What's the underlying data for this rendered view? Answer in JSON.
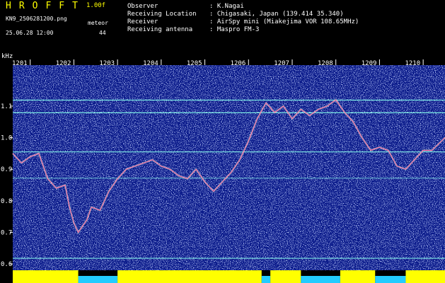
{
  "header": {
    "logo": "HROFFT",
    "version": "1.00f",
    "filename": "KN9_2506281200.png",
    "meteor_label": "meteor",
    "datetime": "25.06.28 12:00",
    "count": "44"
  },
  "info": [
    {
      "label": "Observer",
      "value": ": K.Nagai"
    },
    {
      "label": "Receiving Location",
      "value": ": Chigasaki, Japan (139.414 35.340)"
    },
    {
      "label": "Receiver",
      "value": ": AirSpy mini (Miakejima VOR 108.65MHz)"
    },
    {
      "label": "Receiving antenna",
      "value": ": Maspro FM-3"
    }
  ],
  "colors": {
    "background_noise": "#0a1a8a",
    "trace": "#ff66aa",
    "ref_line": "#88ffee",
    "level_bar": "#ffff00",
    "level_low": "#22ccff",
    "text": "#ffffff",
    "logo": "#ffff00"
  },
  "chart_data": {
    "type": "heatmap",
    "ylabel": "kHz",
    "y_ticks": [
      "1.1",
      "1.0",
      "0.9",
      "0.8",
      "0.7",
      "0.6"
    ],
    "x_ticks": [
      "1201",
      "1202",
      "1203",
      "1204",
      "1205",
      "1206",
      "1207",
      "1208",
      "1209",
      "1210"
    ],
    "ylim": [
      0.58,
      1.23
    ],
    "xlim": [
      1200.6,
      1210.5
    ],
    "reference_lines_khz": [
      1.119,
      1.079,
      0.955,
      0.872,
      0.618
    ],
    "trace": {
      "x": [
        1200.6,
        1200.8,
        1201.0,
        1201.2,
        1201.4,
        1201.6,
        1201.8,
        1201.9,
        1202.0,
        1202.1,
        1202.2,
        1202.3,
        1202.4,
        1202.6,
        1202.8,
        1203.0,
        1203.2,
        1203.4,
        1203.6,
        1203.8,
        1204.0,
        1204.2,
        1204.4,
        1204.6,
        1204.8,
        1205.0,
        1205.2,
        1205.4,
        1205.6,
        1205.8,
        1206.0,
        1206.2,
        1206.4,
        1206.6,
        1206.8,
        1207.0,
        1207.2,
        1207.4,
        1207.6,
        1207.8,
        1208.0,
        1208.2,
        1208.4,
        1208.6,
        1208.8,
        1209.0,
        1209.2,
        1209.4,
        1209.6,
        1209.8,
        1210.0,
        1210.2,
        1210.5
      ],
      "y": [
        0.95,
        0.92,
        0.94,
        0.95,
        0.87,
        0.84,
        0.85,
        0.78,
        0.73,
        0.7,
        0.72,
        0.74,
        0.78,
        0.77,
        0.83,
        0.87,
        0.9,
        0.91,
        0.92,
        0.93,
        0.91,
        0.9,
        0.88,
        0.87,
        0.9,
        0.86,
        0.83,
        0.86,
        0.89,
        0.93,
        0.99,
        1.06,
        1.11,
        1.08,
        1.1,
        1.06,
        1.09,
        1.07,
        1.09,
        1.1,
        1.12,
        1.08,
        1.05,
        1.0,
        0.96,
        0.97,
        0.96,
        0.91,
        0.9,
        0.93,
        0.96,
        0.96,
        1.0
      ]
    },
    "level_bar": [
      {
        "from": 1200.6,
        "to": 1202.1,
        "level": "high"
      },
      {
        "from": 1202.1,
        "to": 1203.0,
        "level": "low"
      },
      {
        "from": 1203.0,
        "to": 1206.3,
        "level": "high"
      },
      {
        "from": 1206.3,
        "to": 1206.5,
        "level": "low"
      },
      {
        "from": 1206.5,
        "to": 1207.2,
        "level": "high"
      },
      {
        "from": 1207.2,
        "to": 1208.1,
        "level": "low"
      },
      {
        "from": 1208.1,
        "to": 1208.9,
        "level": "high"
      },
      {
        "from": 1208.9,
        "to": 1209.6,
        "level": "low"
      },
      {
        "from": 1209.6,
        "to": 1210.5,
        "level": "high"
      }
    ]
  }
}
